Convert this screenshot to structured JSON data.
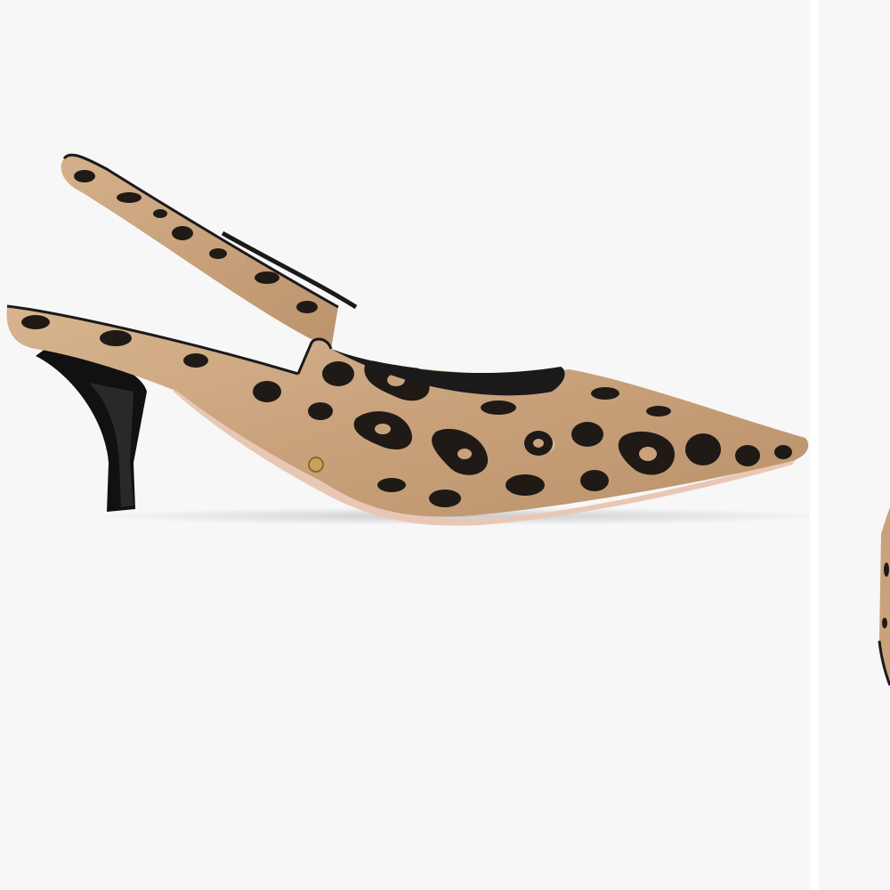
{
  "gallery": {
    "images": [
      {
        "subject": "leopard-print-slingback-kitten-heel-pump",
        "view": "side",
        "current": true
      },
      {
        "subject": "leopard-print-slingback-kitten-heel-pump",
        "view": "partial-next",
        "current": false
      }
    ]
  },
  "colors": {
    "background": "#f7f7f7",
    "separator": "#ffffff",
    "print_base": "#c9a27c",
    "print_light": "#e3c4a0",
    "print_spots": "#1f1a16",
    "heel": "#111111",
    "sole": "#e8c7b4"
  }
}
